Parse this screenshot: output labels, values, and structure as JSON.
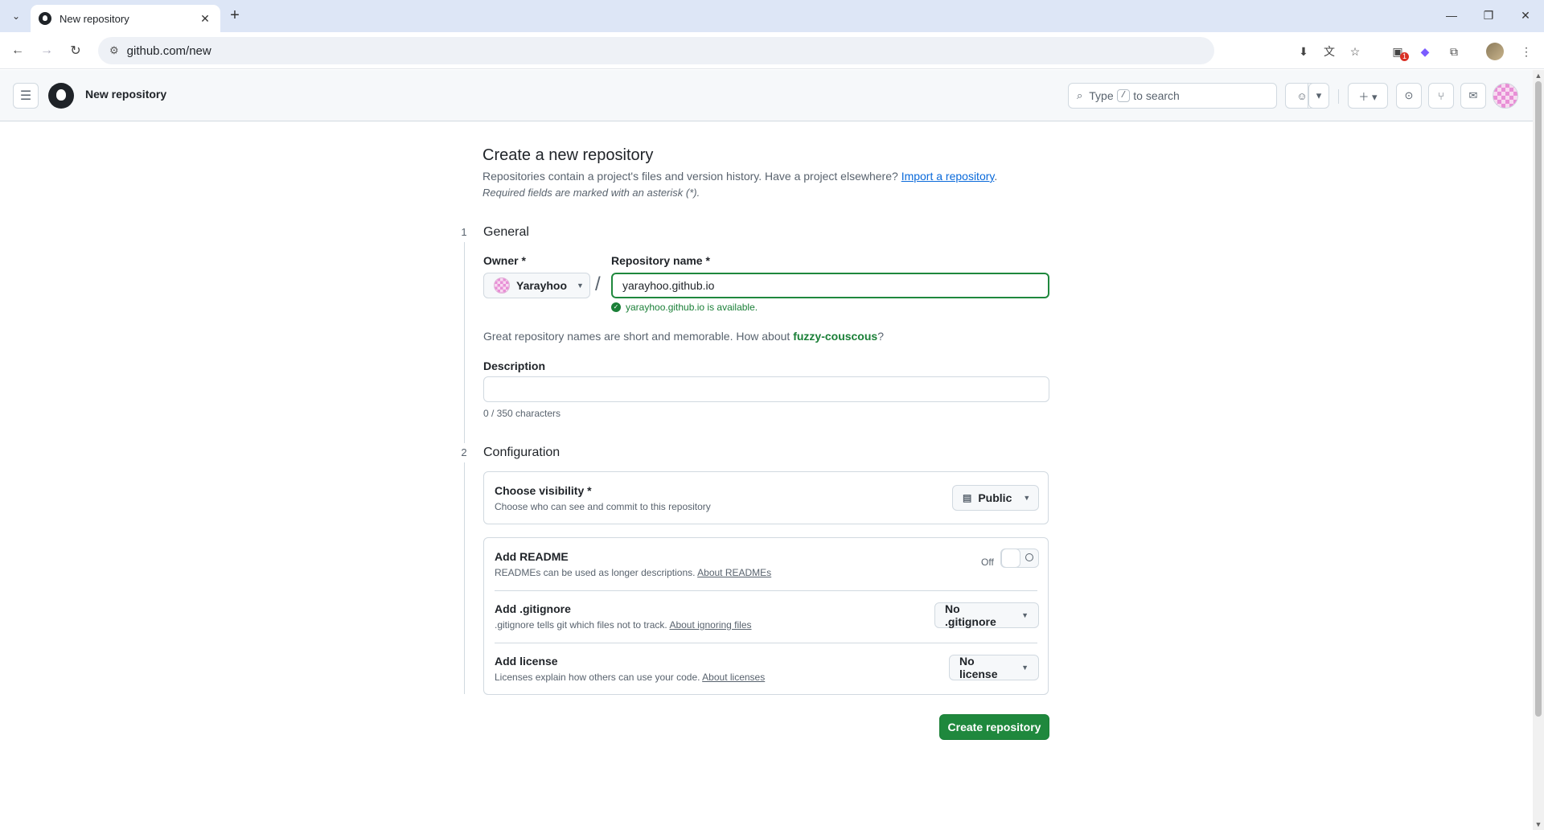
{
  "browser": {
    "tab_title": "New repository",
    "url": "github.com/new",
    "extension_badge": "1"
  },
  "header": {
    "context": "New repository",
    "search": {
      "prefix": "Type",
      "key": "/",
      "suffix": "to search"
    }
  },
  "page": {
    "title": "Create a new repository",
    "subtitle": "Repositories contain a project's files and version history. Have a project elsewhere?",
    "import_link": "Import a repository",
    "subtitle_end": ".",
    "required_note": "Required fields are marked with an asterisk (*)."
  },
  "general": {
    "step": "1",
    "title": "General",
    "owner_label": "Owner *",
    "owner_value": "Yarayhoo",
    "repo_label": "Repository name *",
    "repo_value": "yarayhoo.github.io",
    "availability": "yarayhoo.github.io is available.",
    "suggest_prefix": "Great repository names are short and memorable. How about",
    "suggest_name": "fuzzy-couscous",
    "suggest_suffix": "?",
    "description_label": "Description",
    "description_value": "",
    "char_count": "0 / 350 characters"
  },
  "configuration": {
    "step": "2",
    "title": "Configuration",
    "visibility": {
      "title": "Choose visibility *",
      "desc": "Choose who can see and commit to this repository",
      "value": "Public"
    },
    "readme": {
      "title": "Add README",
      "desc": "READMEs can be used as longer descriptions.",
      "link": "About READMEs",
      "state": "Off"
    },
    "gitignore": {
      "title": "Add .gitignore",
      "desc": ".gitignore tells git which files not to track.",
      "link": "About ignoring files",
      "value": "No .gitignore"
    },
    "license": {
      "title": "Add license",
      "desc": "Licenses explain how others can use your code.",
      "link": "About licenses",
      "value": "No license"
    }
  },
  "actions": {
    "create_label": "Create repository"
  },
  "colors": {
    "primary_green": "#1f883d",
    "link_blue": "#0969da",
    "border": "#d1d9e0",
    "muted": "#59636e"
  }
}
